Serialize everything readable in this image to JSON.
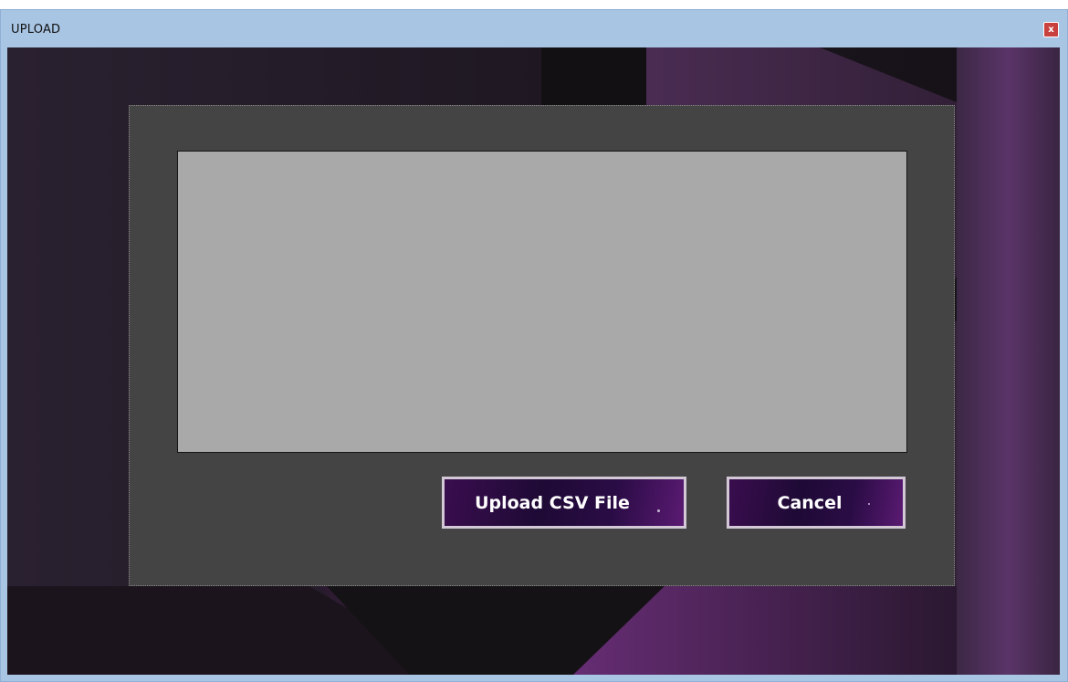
{
  "window": {
    "title": "UPLOAD",
    "close_symbol": "x"
  },
  "actions": {
    "upload_label": "Upload CSV File",
    "cancel_label": "Cancel"
  },
  "colors": {
    "frame": "#a9c5e4",
    "close": "#c9413e",
    "panel": "#444444",
    "list_box": "#a9a9a9",
    "button": "#2a0c45"
  }
}
